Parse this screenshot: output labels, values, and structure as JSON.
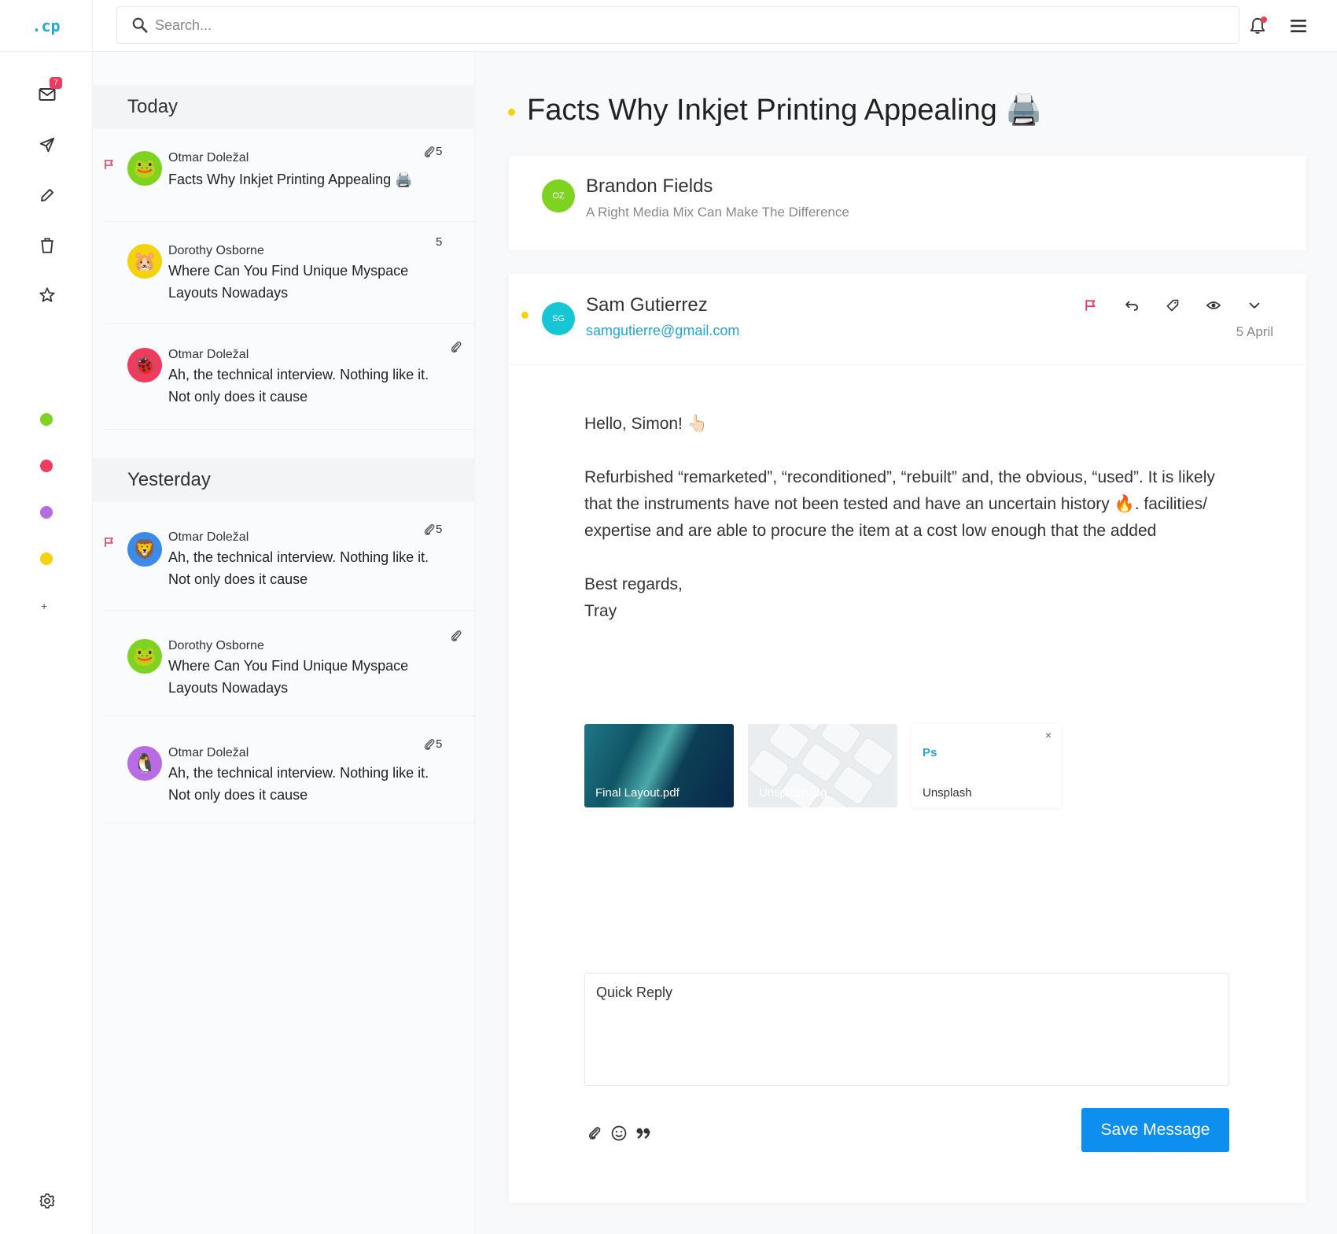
{
  "app": {
    "logo": ".cp"
  },
  "search": {
    "placeholder": "Search..."
  },
  "nav": {
    "inbox_badge": "7"
  },
  "labels": {
    "colors": [
      "#7ed321",
      "#ef3b5d",
      "#b86be3",
      "#f4d30e"
    ],
    "add": "+"
  },
  "mail_groups": [
    {
      "title": "Today",
      "items": [
        {
          "from": "Otmar Doležal",
          "subject": "Facts Why Inkjet  Printing Appealing 🖨️",
          "flagged": true,
          "attachment": true,
          "count": "5",
          "avatar": "🐸",
          "avatar_bg": "#7ed321"
        },
        {
          "from": "Dorothy Osborne",
          "subject": "Where Can You Find Unique Myspace Layouts Nowadays",
          "flagged": false,
          "attachment": false,
          "count": "5",
          "avatar": "🐹",
          "avatar_bg": "#f4d30e"
        },
        {
          "from": "Otmar Doležal",
          "subject": "Ah, the technical interview. Nothing like it. Not only does it cause",
          "flagged": false,
          "attachment": true,
          "count": "",
          "avatar": "🐞",
          "avatar_bg": "#ef3b5d"
        }
      ]
    },
    {
      "title": "Yesterday",
      "items": [
        {
          "from": "Otmar Doležal",
          "subject": "Ah, the technical interview. Nothing like it. Not only does it cause",
          "flagged": true,
          "attachment": true,
          "count": "5",
          "avatar": "🦁",
          "avatar_bg": "#3d8be8"
        },
        {
          "from": "Dorothy Osborne",
          "subject": "Where Can You Find Unique Myspace Layouts Nowadays",
          "flagged": false,
          "attachment": true,
          "count": "",
          "avatar": "🐸",
          "avatar_bg": "#7ed321"
        },
        {
          "from": "Otmar Doležal",
          "subject": "Ah, the technical interview. Nothing like it. Not only does it cause",
          "flagged": false,
          "attachment": true,
          "count": "5",
          "avatar": "🐧",
          "avatar_bg": "#b86be3"
        }
      ]
    }
  ],
  "thread": {
    "title": "Facts Why Inkjet  Printing Appealing 🖨️",
    "previous": {
      "initials": "OZ",
      "name": "Brandon Fields",
      "preview": "A Right Media Mix Can Make The Difference"
    },
    "message": {
      "initials": "SG",
      "name": "Sam Gutierrez",
      "email": "samgutierre@gmail.com",
      "date": "5 April",
      "greeting": "Hello, Simon! 👆🏻",
      "paragraph": "Refurbished  “remarketed”, “reconditioned”, “rebuilt” and, the obvious, “used”. It is likely that the instruments have not been tested and have an uncertain history 🔥.  facilities/ expertise and are able to procure the item at a cost low enough that the added",
      "closing": "Best regards,",
      "signature": "Tray",
      "attachments": [
        {
          "name": "Final Layout.pdf"
        },
        {
          "name": "Unsplash.jpg"
        },
        {
          "name": "Unsplash",
          "badge": "Ps",
          "remove": "×"
        }
      ]
    }
  },
  "reply": {
    "placeholder": "Quick Reply",
    "save_label": "Save Message"
  }
}
